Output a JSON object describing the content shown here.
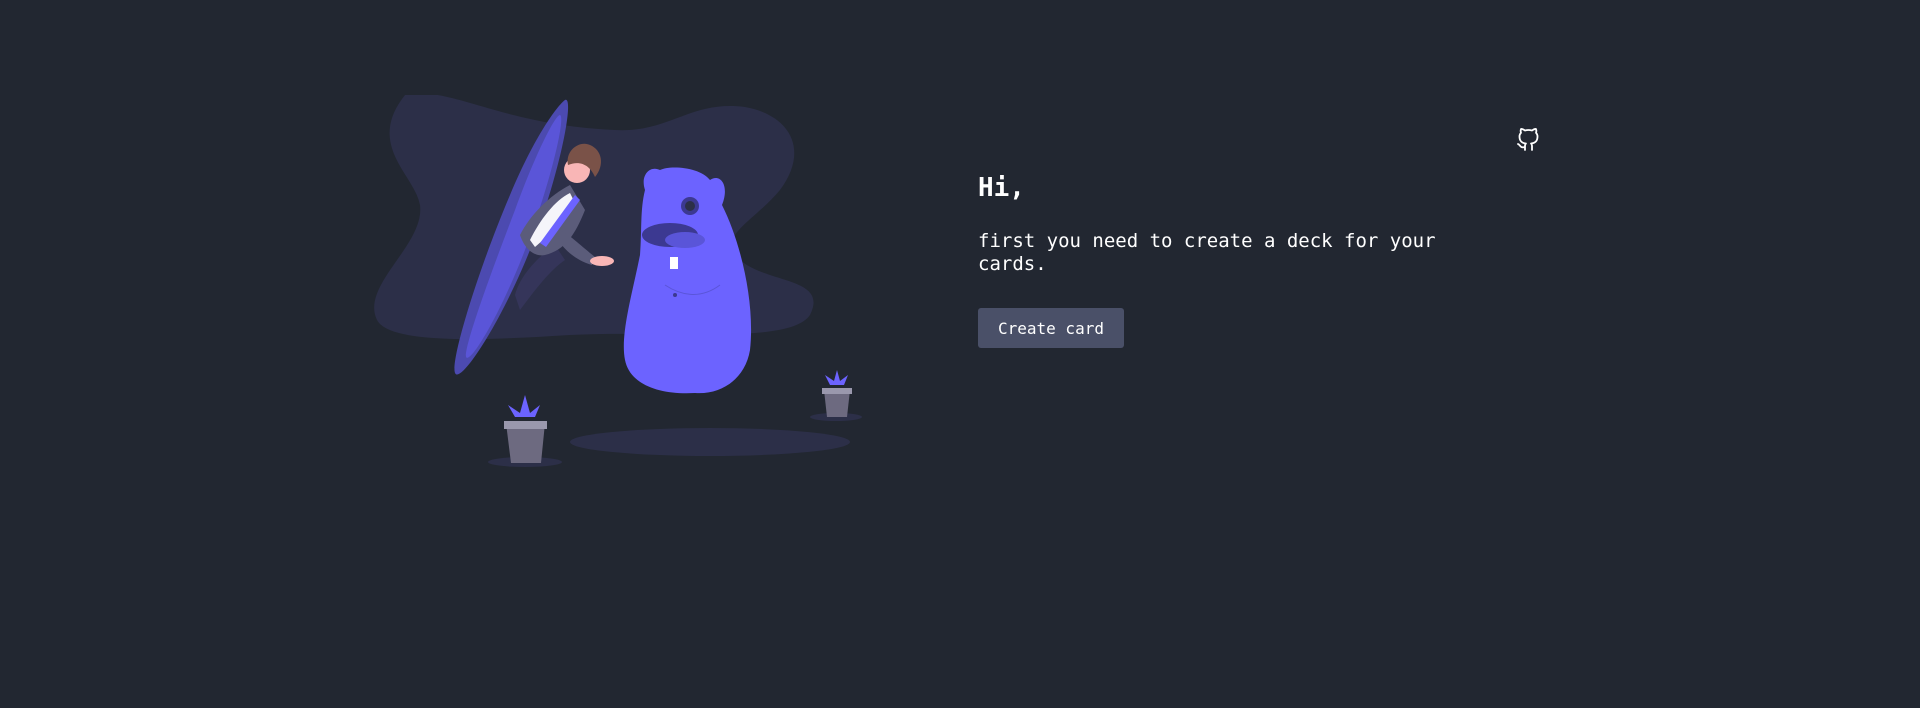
{
  "page": {
    "background_color": "#222731"
  },
  "header": {
    "github_icon": "github-icon"
  },
  "empty_state": {
    "illustration": "portal-monster-illustration",
    "greeting": "Hi,",
    "message": "first you need to create a deck for your cards.",
    "create_button_label": "Create card",
    "accent_color": "#6c63ff",
    "button_color": "#4a5068"
  }
}
